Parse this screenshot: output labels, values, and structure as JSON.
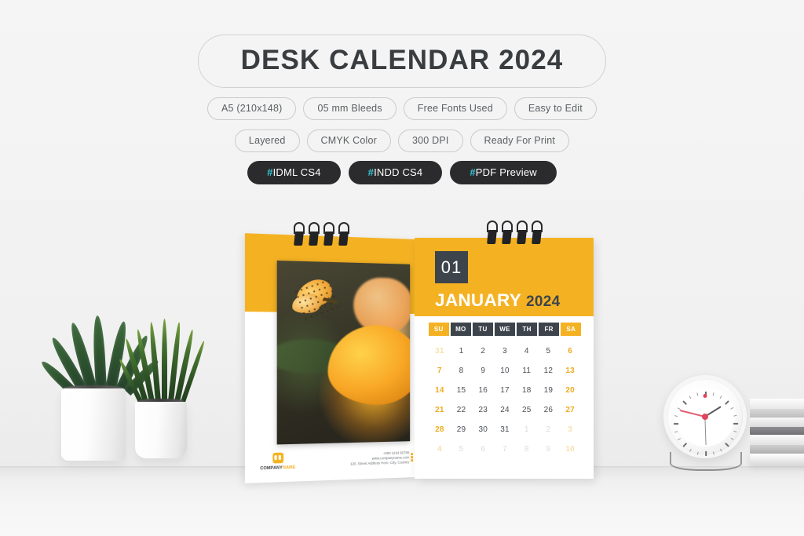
{
  "header": {
    "title": "DESK CALENDAR 2024",
    "feature_tags_row1": [
      "A5 (210x148)",
      "05 mm Bleeds",
      "Free Fonts Used",
      "Easy to Edit"
    ],
    "feature_tags_row2": [
      "Layered",
      "CMYK Color",
      "300 DPI",
      "Ready For Print"
    ],
    "format_pills": [
      {
        "hash": "#",
        "label": "IDML CS4"
      },
      {
        "hash": "#",
        "label": "INDD CS4"
      },
      {
        "hash": "#",
        "label": "PDF Preview"
      }
    ]
  },
  "calendar": {
    "month_number": "01",
    "month_name": "JANUARY",
    "year": "2024",
    "weekday_headers": [
      "SU",
      "MO",
      "TU",
      "WE",
      "TH",
      "FR",
      "SA"
    ],
    "weeks": [
      [
        {
          "d": "31",
          "muted": true,
          "weekend": true
        },
        {
          "d": "1",
          "muted": false,
          "weekend": false
        },
        {
          "d": "2",
          "muted": false,
          "weekend": false
        },
        {
          "d": "3",
          "muted": false,
          "weekend": false
        },
        {
          "d": "4",
          "muted": false,
          "weekend": false
        },
        {
          "d": "5",
          "muted": false,
          "weekend": false
        },
        {
          "d": "6",
          "muted": false,
          "weekend": true
        }
      ],
      [
        {
          "d": "7",
          "muted": false,
          "weekend": true
        },
        {
          "d": "8",
          "muted": false,
          "weekend": false
        },
        {
          "d": "9",
          "muted": false,
          "weekend": false
        },
        {
          "d": "10",
          "muted": false,
          "weekend": false
        },
        {
          "d": "11",
          "muted": false,
          "weekend": false
        },
        {
          "d": "12",
          "muted": false,
          "weekend": false
        },
        {
          "d": "13",
          "muted": false,
          "weekend": true
        }
      ],
      [
        {
          "d": "14",
          "muted": false,
          "weekend": true
        },
        {
          "d": "15",
          "muted": false,
          "weekend": false
        },
        {
          "d": "16",
          "muted": false,
          "weekend": false
        },
        {
          "d": "17",
          "muted": false,
          "weekend": false
        },
        {
          "d": "18",
          "muted": false,
          "weekend": false
        },
        {
          "d": "19",
          "muted": false,
          "weekend": false
        },
        {
          "d": "20",
          "muted": false,
          "weekend": true
        }
      ],
      [
        {
          "d": "21",
          "muted": false,
          "weekend": true
        },
        {
          "d": "22",
          "muted": false,
          "weekend": false
        },
        {
          "d": "23",
          "muted": false,
          "weekend": false
        },
        {
          "d": "24",
          "muted": false,
          "weekend": false
        },
        {
          "d": "25",
          "muted": false,
          "weekend": false
        },
        {
          "d": "26",
          "muted": false,
          "weekend": false
        },
        {
          "d": "27",
          "muted": false,
          "weekend": true
        }
      ],
      [
        {
          "d": "28",
          "muted": false,
          "weekend": true
        },
        {
          "d": "29",
          "muted": false,
          "weekend": false
        },
        {
          "d": "30",
          "muted": false,
          "weekend": false
        },
        {
          "d": "31",
          "muted": false,
          "weekend": false
        },
        {
          "d": "1",
          "muted": true,
          "weekend": false
        },
        {
          "d": "2",
          "muted": true,
          "weekend": false
        },
        {
          "d": "3",
          "muted": true,
          "weekend": true
        }
      ],
      [
        {
          "d": "4",
          "muted": true,
          "weekend": true
        },
        {
          "d": "5",
          "muted": true,
          "weekend": false
        },
        {
          "d": "6",
          "muted": true,
          "weekend": false
        },
        {
          "d": "7",
          "muted": true,
          "weekend": false
        },
        {
          "d": "8",
          "muted": true,
          "weekend": false
        },
        {
          "d": "9",
          "muted": true,
          "weekend": false
        },
        {
          "d": "10",
          "muted": true,
          "weekend": true
        }
      ]
    ],
    "footer": {
      "brand_company": "COMPANY",
      "brand_name": "NAME",
      "phone": "+000 1234 56789",
      "website": "www.companyname.com",
      "address": "120, Street Address Here, City, Country"
    },
    "cover_photo_alt": "butterfly-on-orange-flower-photo"
  },
  "colors": {
    "accent_orange": "#f4b223",
    "dark_charcoal": "#3e444b",
    "pill_dark": "#2b2b2d",
    "hash_cyan": "#35c4d4",
    "title_text": "#3a3d40",
    "tag_text": "#5c6063"
  },
  "scene": {
    "plant_large_alt": "aloe-plant-in-white-pot",
    "plant_small_alt": "snake-plant-in-white-pot",
    "clock_alt": "white-desk-clock",
    "books_alt": "stack-of-books"
  }
}
